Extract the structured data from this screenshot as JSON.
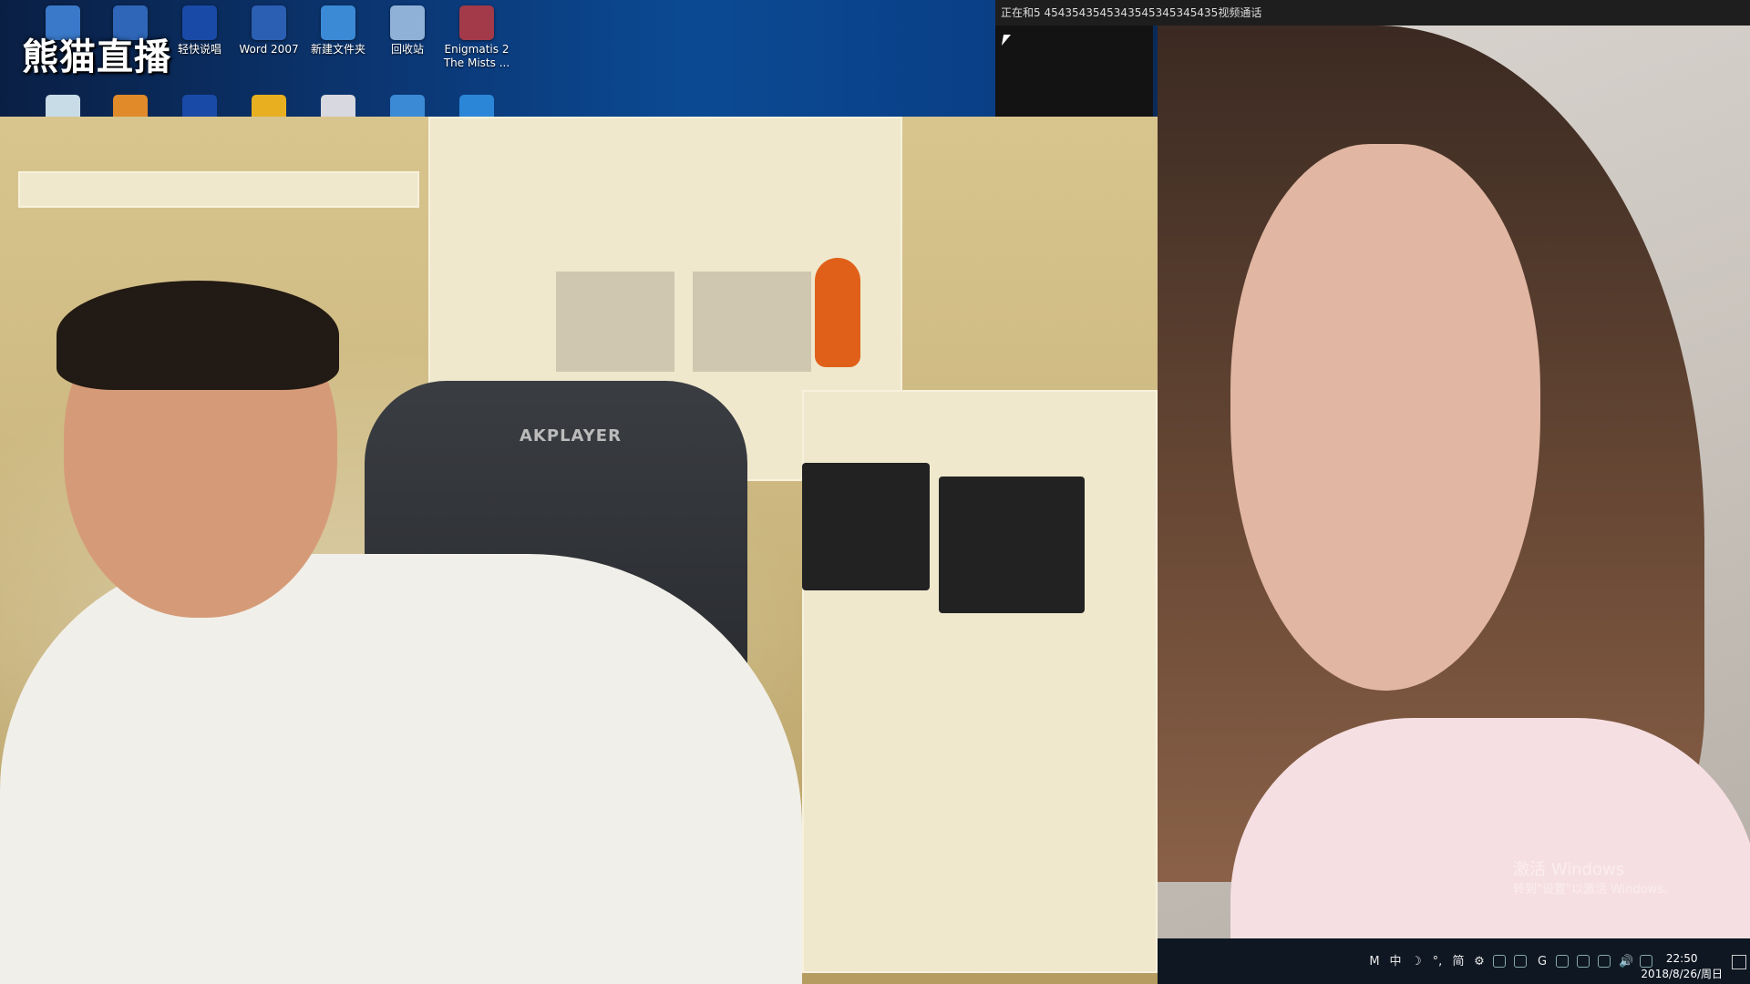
{
  "desktop": {
    "watermark": "熊猫直播",
    "icons": [
      {
        "label": "",
        "icon": "document-icon",
        "color": "#3a79c9"
      },
      {
        "label": "",
        "icon": "document-icon",
        "color": "#2f66b8"
      },
      {
        "label": "轻快说唱",
        "icon": "kx-app-icon",
        "color": "#1a4aa8"
      },
      {
        "label": "Word 2007",
        "icon": "word-icon",
        "color": "#2b5fb3"
      },
      {
        "label": "新建文件夹",
        "icon": "folder-icon",
        "color": "#3b8ad6"
      },
      {
        "label": "回收站",
        "icon": "recycle-bin-icon",
        "color": "#8fb1d8"
      },
      {
        "label": "Enigmatis 2 The Mists ...",
        "icon": "game-icon",
        "color": "#a23a4a"
      }
    ],
    "icons_row2": [
      {
        "icon": "browser-icon",
        "color": "#c8dce8"
      },
      {
        "icon": "app-icon",
        "color": "#e08a2a"
      },
      {
        "icon": "kx-app-icon",
        "color": "#1a4aa8"
      },
      {
        "icon": "cat-icon",
        "color": "#e8b020"
      },
      {
        "icon": "gamepad-icon",
        "color": "#d8d8e0"
      },
      {
        "icon": "globe-icon",
        "color": "#3a8ad6"
      },
      {
        "icon": "f-app-icon",
        "color": "#2b86d8"
      }
    ]
  },
  "call_window": {
    "title": "正在和5 4543543545343545345345435视频通话"
  },
  "main_cam": {
    "chair_brand": "AKPLAYER"
  },
  "remote_cam": {
    "activate_line1": "激活 Windows",
    "activate_line2": "转到\"设置\"以激活 Windows。"
  },
  "taskbar": {
    "tray_icons": [
      "M",
      "中",
      "☽",
      "°,",
      "简",
      "⚙",
      "",
      "",
      "G",
      "",
      "",
      "",
      "🔊",
      ""
    ],
    "time": "22:50",
    "date": "2018/8/26/周日"
  }
}
